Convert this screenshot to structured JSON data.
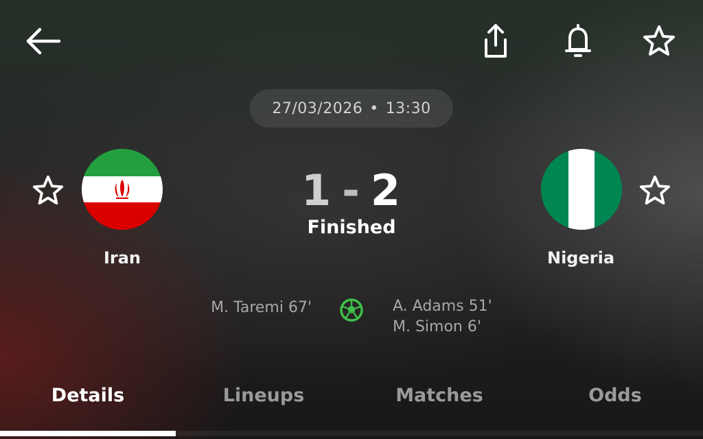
{
  "header": {
    "icons": [
      "back-arrow-icon",
      "share-icon",
      "bell-icon",
      "star-icon"
    ]
  },
  "match": {
    "date": "27/03/2026",
    "separator": "•",
    "time": "13:30",
    "status": "Finished",
    "score": {
      "home": "1",
      "dash": "-",
      "away": "2"
    }
  },
  "home_team": {
    "name": "Iran",
    "flag_colors": [
      "#239f40",
      "#ffffff",
      "#da0000"
    ],
    "scorers": [
      {
        "text": "M. Taremi 67'"
      }
    ]
  },
  "away_team": {
    "name": "Nigeria",
    "flag_colors": [
      "#008751",
      "#ffffff",
      "#008751"
    ],
    "scorers": [
      {
        "text": "A. Adams 51'"
      },
      {
        "text": "M. Simon 6'"
      }
    ]
  },
  "goal_icon": {
    "name": "soccer-ball-icon",
    "color": "#3fbf4a"
  },
  "tabs": [
    {
      "label": "Details",
      "active": true
    },
    {
      "label": "Lineups",
      "active": false
    },
    {
      "label": "Matches",
      "active": false
    },
    {
      "label": "Odds",
      "active": false
    }
  ]
}
